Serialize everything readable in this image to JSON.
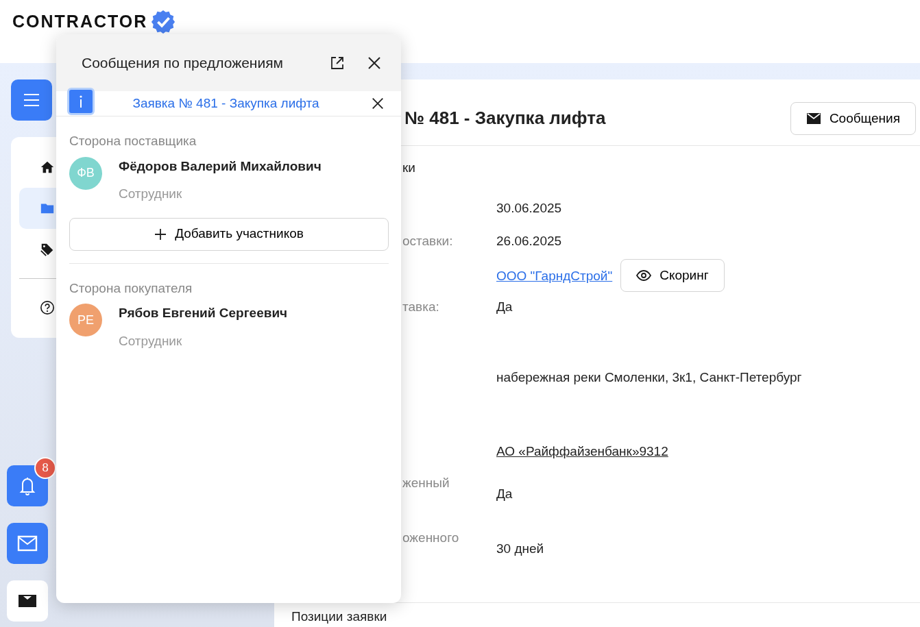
{
  "logo": {
    "text": "CONTRACTOR"
  },
  "sidebar": {
    "items": [
      {
        "kind": "home",
        "selected": false
      },
      {
        "kind": "folder",
        "selected": true
      },
      {
        "kind": "tags",
        "selected": false
      },
      {
        "kind": "help",
        "selected": false
      }
    ]
  },
  "floating_buttons": [
    {
      "kind": "bell",
      "badge": "8"
    },
    {
      "kind": "mail"
    },
    {
      "kind": "mail-dark"
    }
  ],
  "page": {
    "title": "№ 481 - Закупка лифта",
    "messages_button": "Сообщения",
    "section_label": "ки",
    "rows": [
      {
        "kind": "text",
        "value": "30.06.2025"
      },
      {
        "kind": "text",
        "label": "оставки:",
        "value": "26.06.2025"
      },
      {
        "kind": "company",
        "value": "ООО \"ГарндСтрой\"",
        "button": "Скоринг"
      },
      {
        "kind": "text",
        "label": "тавка:",
        "value": "Да"
      },
      {
        "kind": "text",
        "value": "набережная реки Смоленки, 3к1, Санкт-Петербург"
      },
      {
        "kind": "bank",
        "value": "АО «Райффайзенбанк»9312"
      },
      {
        "kind": "text",
        "label": "женный",
        "value": "Да"
      },
      {
        "kind": "text",
        "label": "оженного",
        "value": "30 дней"
      }
    ],
    "footer_section": "Позиции заявки"
  },
  "messages_panel": {
    "title": "Сообщения по предложениям",
    "chat": {
      "title": "Заявка № 481 - Закупка лифта"
    },
    "groups": [
      {
        "title": "Сторона поставщика",
        "members": [
          {
            "initials": "ФВ",
            "name": "Фёдоров Валерий Михайлович",
            "role": "Сотрудник",
            "color": "#80d6cf"
          }
        ],
        "add_button": "Добавить участников"
      },
      {
        "title": "Сторона покупателя",
        "members": [
          {
            "initials": "РЕ",
            "name": "Рябов Евгений Сергеевич",
            "role": "Сотрудник",
            "color": "#f0a06e"
          }
        ]
      }
    ]
  }
}
